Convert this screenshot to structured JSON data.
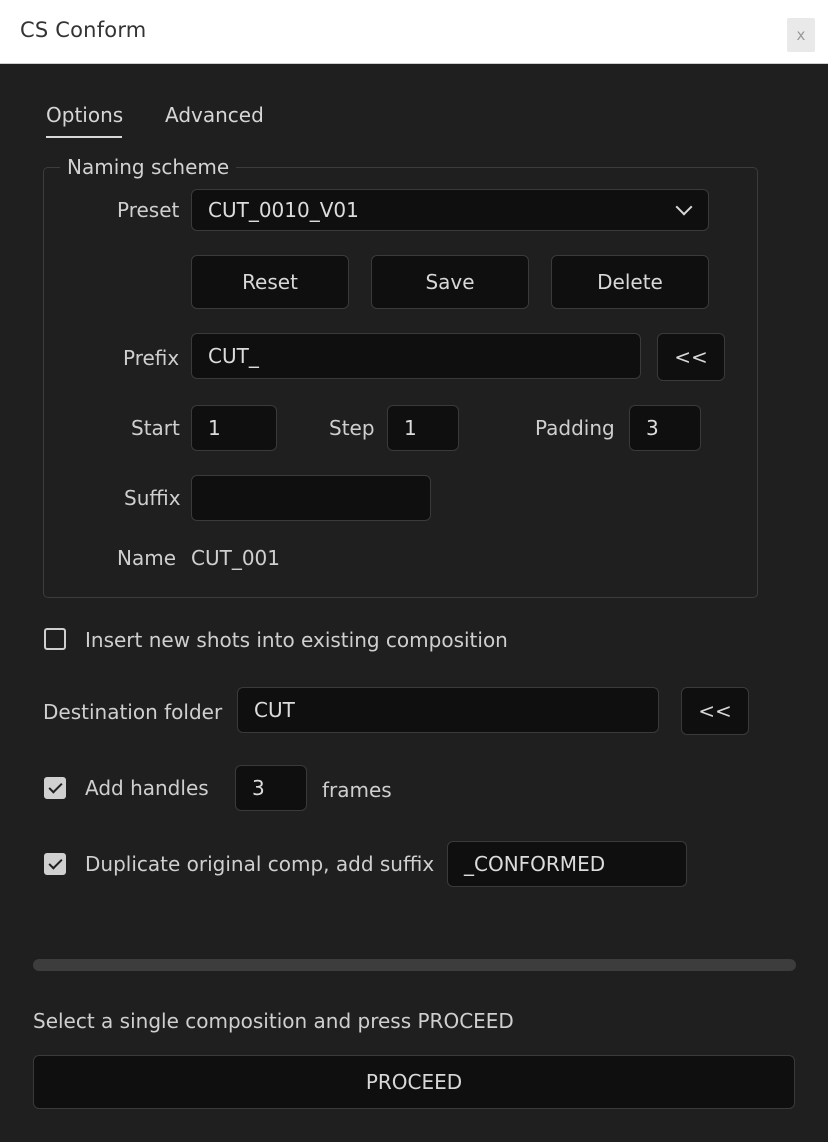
{
  "window": {
    "title": "CS Conform",
    "close_label": "x"
  },
  "tabs": {
    "options": "Options",
    "advanced": "Advanced"
  },
  "naming": {
    "legend": "Naming scheme",
    "preset_label": "Preset",
    "preset_value": "CUT_0010_V01",
    "reset_label": "Reset",
    "save_label": "Save",
    "delete_label": "Delete",
    "prefix_label": "Prefix",
    "prefix_value": "CUT_",
    "prefix_pick_label": "<<",
    "start_label": "Start",
    "start_value": "1",
    "step_label": "Step",
    "step_value": "1",
    "padding_label": "Padding",
    "padding_value": "3",
    "suffix_label": "Suffix",
    "suffix_value": "",
    "name_label": "Name",
    "name_value": "CUT_001"
  },
  "options": {
    "insert_label": "Insert new shots into existing composition",
    "insert_checked": false,
    "destination_label": "Destination folder",
    "destination_value": "CUT",
    "destination_pick_label": "<<",
    "handles_label": "Add handles",
    "handles_checked": true,
    "handles_value": "3",
    "handles_unit": "frames",
    "duplicate_label": "Duplicate original comp, add suffix",
    "duplicate_checked": true,
    "duplicate_value": "_CONFORMED"
  },
  "progress": {
    "value": 0
  },
  "status_text": "Select a single composition and press PROCEED",
  "proceed_label": "PROCEED"
}
